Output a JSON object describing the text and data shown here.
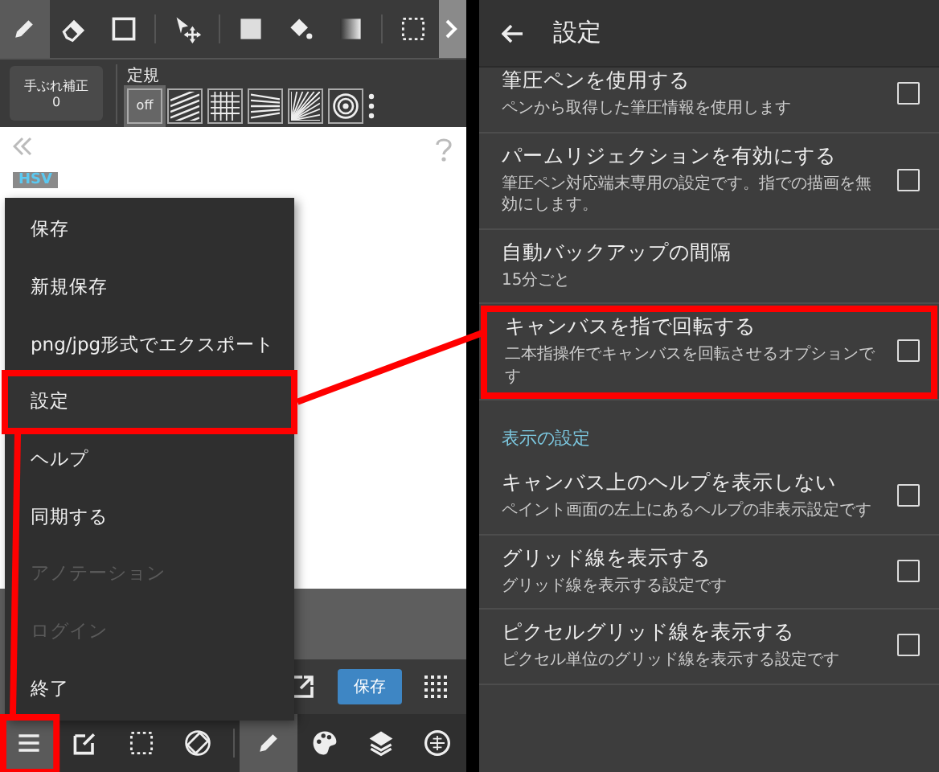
{
  "left": {
    "tools": [
      {
        "kind": "pencil",
        "selected": true
      },
      {
        "kind": "eraser",
        "selected": false
      },
      {
        "kind": "rectangle",
        "selected": false
      },
      {
        "kind": "move",
        "selected": false
      },
      {
        "kind": "fill",
        "selected": false
      },
      {
        "kind": "bucket",
        "selected": false
      },
      {
        "kind": "gradient",
        "selected": false
      },
      {
        "kind": "selection",
        "selected": false
      }
    ],
    "stabilizer": {
      "label": "手ぶれ補正",
      "value": "0"
    },
    "ruler": {
      "label": "定規",
      "options": [
        {
          "kind": "off",
          "text": "off",
          "selected": true
        },
        {
          "kind": "parallel",
          "selected": false
        },
        {
          "kind": "grid",
          "selected": false
        },
        {
          "kind": "perspective",
          "selected": false
        },
        {
          "kind": "radial",
          "selected": false
        },
        {
          "kind": "circle",
          "selected": false
        }
      ]
    },
    "color_tab": "HSV",
    "menu": [
      {
        "label": "保存",
        "disabled": false,
        "selected": false
      },
      {
        "label": "新規保存",
        "disabled": false,
        "selected": false
      },
      {
        "label": "png/jpg形式でエクスポート",
        "disabled": false,
        "selected": false
      },
      {
        "label": "設定",
        "disabled": false,
        "selected": true
      },
      {
        "label": "ヘルプ",
        "disabled": false,
        "selected": false
      },
      {
        "label": "同期する",
        "disabled": false,
        "selected": false
      },
      {
        "label": "アノテーション",
        "disabled": true,
        "selected": false
      },
      {
        "label": "ログイン",
        "disabled": true,
        "selected": false
      },
      {
        "label": "終了",
        "disabled": false,
        "selected": false
      }
    ],
    "save_button": "保存",
    "bottom_tools": [
      {
        "kind": "menu",
        "selected": true
      },
      {
        "kind": "edit",
        "selected": false
      },
      {
        "kind": "selection",
        "selected": false
      },
      {
        "kind": "rotate",
        "selected": false
      },
      {
        "kind": "pencil",
        "selected": true
      },
      {
        "kind": "palette",
        "selected": false
      },
      {
        "kind": "layers",
        "selected": false
      },
      {
        "kind": "globe",
        "selected": false
      }
    ]
  },
  "right": {
    "title": "設定",
    "items": [
      {
        "kind": "checkbox",
        "title": "筆圧ペンを使用する",
        "subtitle": "ペンから取得した筆圧情報を使用します",
        "checked": false,
        "highlighted": false
      },
      {
        "kind": "checkbox",
        "title": "パームリジェクションを有効にする",
        "subtitle": "筆圧ペン対応端末専用の設定です。指での描画を無効にします。",
        "checked": false,
        "highlighted": false
      },
      {
        "kind": "value",
        "title": "自動バックアップの間隔",
        "subtitle": "15分ごと",
        "highlighted": false
      },
      {
        "kind": "checkbox",
        "title": "キャンバスを指で回転する",
        "subtitle": "二本指操作でキャンバスを回転させるオプションです",
        "checked": false,
        "highlighted": true
      },
      {
        "kind": "section",
        "title": "表示の設定"
      },
      {
        "kind": "checkbox",
        "title": "キャンバス上のヘルプを表示しない",
        "subtitle": "ペイント画面の左上にあるヘルプの非表示設定です",
        "checked": false,
        "highlighted": false
      },
      {
        "kind": "checkbox",
        "title": "グリッド線を表示する",
        "subtitle": "グリッド線を表示する設定です",
        "checked": false,
        "highlighted": false
      },
      {
        "kind": "checkbox",
        "title": "ピクセルグリッド線を表示する",
        "subtitle": "ピクセル単位のグリッド線を表示する設定です",
        "checked": false,
        "highlighted": false
      }
    ]
  }
}
